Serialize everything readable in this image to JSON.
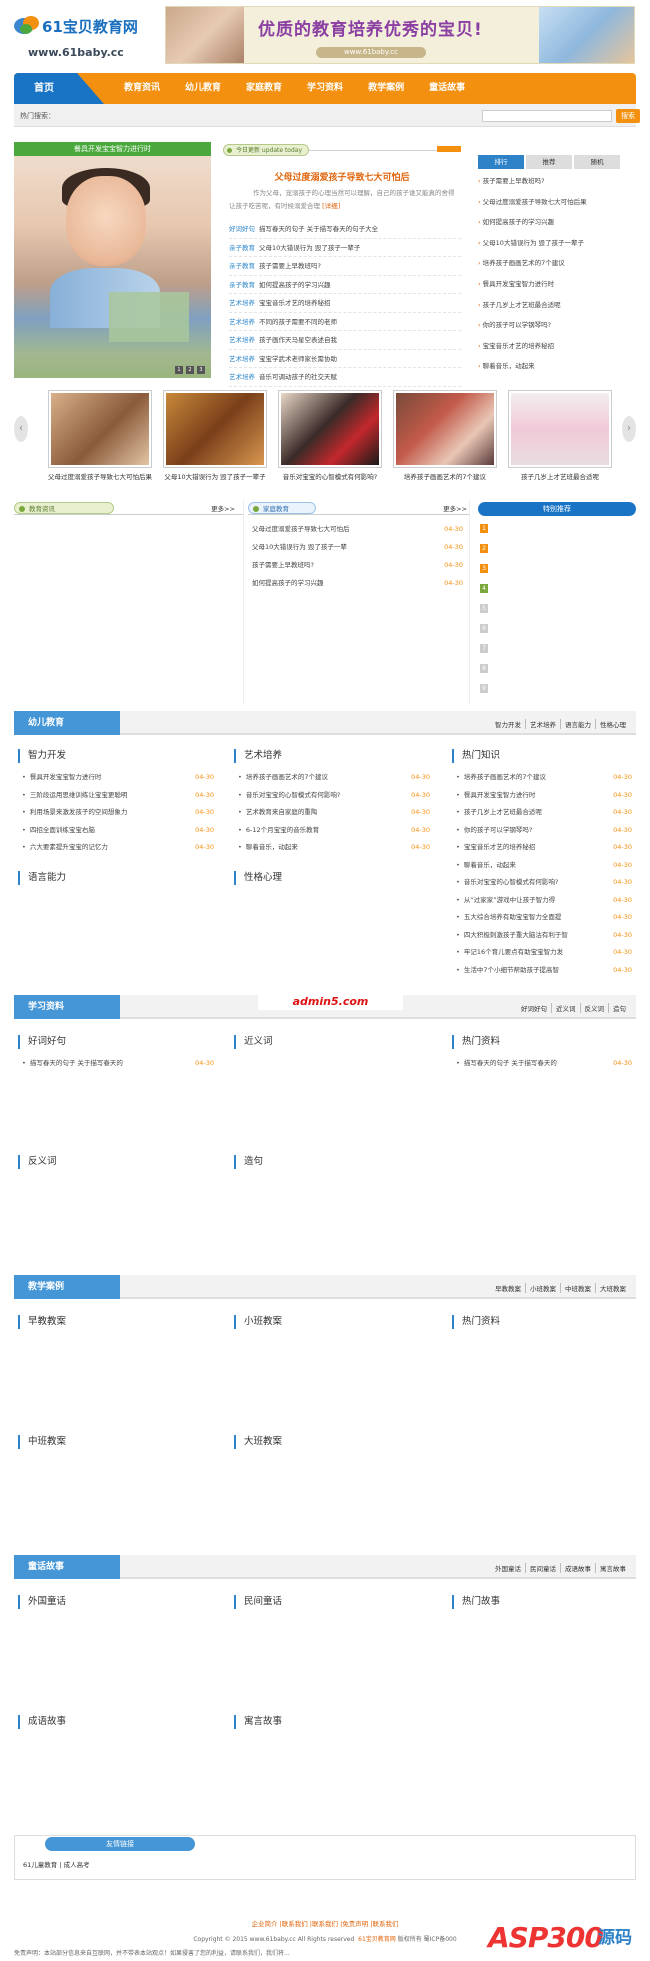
{
  "header": {
    "logo_name": "61宝贝教育网",
    "logo_url": "www.61baby.cc",
    "banner_slogan": "优质的教育培养优秀的宝贝!",
    "banner_url": "www.61baby.cc"
  },
  "nav": {
    "home": "首页",
    "items": [
      "教育资讯",
      "幼儿教育",
      "家庭教育",
      "学习资料",
      "教学案例",
      "童话故事"
    ]
  },
  "search": {
    "label": "热门搜索：",
    "placeholder": "",
    "button": "搜索"
  },
  "focus": {
    "caption": "餐具开发宝宝智力进行时",
    "dots": [
      "1",
      "2",
      "3"
    ]
  },
  "today": {
    "tag": "今日更新 update today",
    "headline": "父母过度溺爱孩子导致七大可怕后",
    "desc": "作为父母，宠溺孩子的心理当然可以理解，自己的孩子谁又能真的舍得让孩子吃苦呢，有时候溺爱合理",
    "desc_more": "[详细]",
    "items": [
      {
        "cat": "好词好句",
        "text": "描写春天的句子 关于描写春天的句子大全"
      },
      {
        "cat": "亲子教育",
        "text": "父母10大错误行为 毁了孩子一辈子"
      },
      {
        "cat": "亲子教育",
        "text": "孩子需要上早教班吗?"
      },
      {
        "cat": "亲子教育",
        "text": "如何提高孩子的学习兴趣"
      },
      {
        "cat": "艺术培养",
        "text": "宝宝音乐才艺的培养秘招"
      },
      {
        "cat": "艺术培养",
        "text": "不同的孩子需要不同的老师"
      },
      {
        "cat": "艺术培养",
        "text": "孩子画作天马星空表述自我"
      },
      {
        "cat": "艺术培养",
        "text": "宝宝学武术老师家长需协助"
      },
      {
        "cat": "艺术培养",
        "text": "音乐可调动孩子的社交天赋"
      }
    ]
  },
  "rank": {
    "tabs": [
      "排行",
      "推荐",
      "随机"
    ],
    "items": [
      "孩子需要上早教班吗?",
      "父母过度溺爱孩子导致七大可怕后果",
      "如何提高孩子的学习兴趣",
      "父母10大错误行为 毁了孩子一辈子",
      "培养孩子画画艺术的7个建议",
      "餐具开发宝宝智力进行时",
      "孩子几岁上才艺班最合适呢",
      "你的孩子可以学钢琴吗?",
      "宝宝音乐才艺的培养秘招",
      "聊着音乐，动起来"
    ]
  },
  "strip": {
    "left_arrow": "‹",
    "right_arrow": "›",
    "items": [
      "父母过度溺爱孩子导致七大可怕后果",
      "父母10大错误行为 毁了孩子一辈子",
      "音乐对宝宝的心智模式有何影响?",
      "培养孩子画画艺术的7个建议",
      "孩子几岁上才艺班最合适呢"
    ]
  },
  "news_box": {
    "title": "教育资讯",
    "more": "更多>>"
  },
  "family_box": {
    "title": "家庭教育",
    "more": "更多>>",
    "items": [
      {
        "t": "父母过度溺爱孩子导致七大可怕后",
        "d": "04-30"
      },
      {
        "t": "父母10大错误行为 毁了孩子一辈",
        "d": "04-30"
      },
      {
        "t": "孩子需要上早教班吗?",
        "d": "04-30"
      },
      {
        "t": "如何提高孩子的学习兴趣",
        "d": "04-30"
      }
    ]
  },
  "special_box": {
    "title": "特别推荐",
    "nums": [
      "1",
      "2",
      "3",
      "4",
      "5",
      "6",
      "7",
      "8",
      "9",
      "10"
    ]
  },
  "sec_youer": {
    "title": "幼儿教育",
    "tags": [
      "智力开发",
      "艺术培养",
      "语言能力",
      "性格心理"
    ],
    "zhili": {
      "h": "智力开发",
      "items": [
        {
          "t": "餐具开发宝宝智力进行时",
          "d": "04-30"
        },
        {
          "t": "三阶段运用思维训练让宝宝更聪明",
          "d": "04-30"
        },
        {
          "t": "利用场景来激发孩子的空间想象力",
          "d": "04-30"
        },
        {
          "t": "四招全面训练宝宝右脑",
          "d": "04-30"
        },
        {
          "t": "六大要素提升宝宝的记忆力",
          "d": "04-30"
        }
      ]
    },
    "yishu": {
      "h": "艺术培养",
      "items": [
        {
          "t": "培养孩子画画艺术的7个建议",
          "d": "04-30"
        },
        {
          "t": "音乐对宝宝的心智模式有何影响?",
          "d": "04-30"
        },
        {
          "t": "艺术教育来自家庭的重陶",
          "d": "04-30"
        },
        {
          "t": "6-12个月宝宝的音乐教育",
          "d": "04-30"
        },
        {
          "t": "聊着音乐，动起来",
          "d": "04-30"
        }
      ]
    },
    "hot": {
      "h": "热门知识",
      "items": [
        {
          "t": "培养孩子画画艺术的7个建议",
          "d": "04-30"
        },
        {
          "t": "餐具开发宝宝智力进行时",
          "d": "04-30"
        },
        {
          "t": "孩子几岁上才艺班最合适呢",
          "d": "04-30"
        },
        {
          "t": "你的孩子可以学钢琴吗?",
          "d": "04-30"
        },
        {
          "t": "宝宝音乐才艺的培养秘招",
          "d": "04-30"
        },
        {
          "t": "聊着音乐，动起来",
          "d": "04-30"
        },
        {
          "t": "音乐对宝宝的心智模式有何影响?",
          "d": "04-30"
        },
        {
          "t": "从“过家家”游戏中让孩子智力得",
          "d": "04-30"
        },
        {
          "t": "五大综合培养有助宝宝智力全面提",
          "d": "04-30"
        },
        {
          "t": "四大积极刺激孩子重大脑沽有利于智",
          "d": "04-30"
        },
        {
          "t": "牢记16个育儿要点有助宝宝智力发",
          "d": "04-30"
        },
        {
          "t": "生活中7个小细节帮助孩子提高智",
          "d": "04-30"
        }
      ]
    },
    "yuyan": {
      "h": "语言能力"
    },
    "xingge": {
      "h": "性格心理"
    }
  },
  "sec_xuexi": {
    "title": "学习资料",
    "ad": "admin5.com",
    "tags": [
      "好词好句",
      "近义词",
      "反义词",
      "造句"
    ],
    "haoci": {
      "h": "好词好句",
      "items": [
        {
          "t": "描写春天的句子 关于描写春天的",
          "d": "04-30"
        }
      ]
    },
    "jinyi": {
      "h": "近义词"
    },
    "hot": {
      "h": "热门资料",
      "items": [
        {
          "t": "描写春天的句子 关于描写春天的",
          "d": "04-30"
        }
      ]
    },
    "fanyi": {
      "h": "反义词"
    },
    "zaoju": {
      "h": "造句"
    }
  },
  "sec_jiaoxue": {
    "title": "教学案例",
    "tags": [
      "早教教案",
      "小班教案",
      "中班教案",
      "大班教案"
    ],
    "c1": "早教教案",
    "c2": "小班教案",
    "c3": "热门资料",
    "c4": "中班教案",
    "c5": "大班教案"
  },
  "sec_tonghua": {
    "title": "童话故事",
    "tags": [
      "外国童话",
      "民间童话",
      "成语故事",
      "寓言故事"
    ],
    "c1": "外国童话",
    "c2": "民间童话",
    "c3": "热门故事",
    "c4": "成语故事",
    "c5": "寓言故事"
  },
  "links": {
    "title": "友情链接",
    "items": "61儿童教育 | 成人高考"
  },
  "footer": {
    "line1": "企业简介 |联系我们 |联系我们 |免责声明 |联系我们",
    "copyright": "Copyright © 2015 www.61baby.cc All Rights reserved",
    "site": "61宝贝教育网",
    "rights": "版权所有 蜀ICP备000",
    "disclaimer": "免责声明：本站部分信息来自互联网，并不带表本站观点！如果侵害了您的利益，请联系我们，我们将...",
    "watermark": "ASP300",
    "watermark_sub": "源码"
  }
}
